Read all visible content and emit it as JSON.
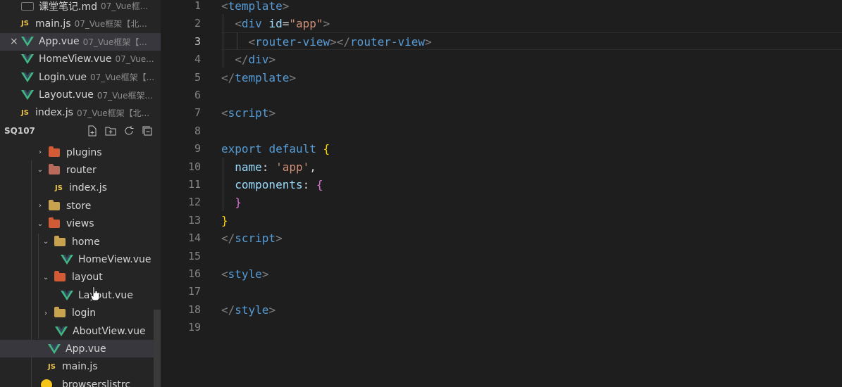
{
  "open_editors": [
    {
      "name": "课堂笔记.md",
      "desc": "07_Vue框...",
      "icon": "markdown-icon"
    },
    {
      "name": "main.js",
      "desc": "07_Vue框架【北...",
      "icon": "js-icon"
    },
    {
      "name": "App.vue",
      "desc": "07_Vue框架【...",
      "icon": "vue-icon",
      "close": "×",
      "selected": true
    },
    {
      "name": "HomeView.vue",
      "desc": "07_Vue...",
      "icon": "vue-icon"
    },
    {
      "name": "Login.vue",
      "desc": "07_Vue框架【...",
      "icon": "vue-icon"
    },
    {
      "name": "Layout.vue",
      "desc": "07_Vue框架...",
      "icon": "vue-icon"
    },
    {
      "name": "index.js",
      "desc": "07_Vue框架【北...",
      "icon": "js-icon"
    }
  ],
  "explorer": {
    "root": "SQ107",
    "actions": [
      "new-file-icon",
      "new-folder-icon",
      "refresh-icon",
      "collapse-all-icon"
    ],
    "tree": [
      {
        "name": "plugins",
        "type": "folder",
        "chevron": "›",
        "folder": "special"
      },
      {
        "name": "router",
        "type": "folder",
        "chevron": "⌄",
        "folder": "router"
      },
      {
        "name": "index.js",
        "type": "js"
      },
      {
        "name": "store",
        "type": "folder",
        "chevron": "›",
        "folder": "plain"
      },
      {
        "name": "views",
        "type": "folder",
        "chevron": "⌄",
        "folder": "special"
      },
      {
        "name": "home",
        "type": "folder",
        "chevron": "⌄",
        "folder": "plain"
      },
      {
        "name": "HomeView.vue",
        "type": "vue"
      },
      {
        "name": "layout",
        "type": "folder",
        "chevron": "⌄",
        "folder": "special"
      },
      {
        "name": "Layout.vue",
        "type": "vue"
      },
      {
        "name": "login",
        "type": "folder",
        "chevron": "›",
        "folder": "plain"
      },
      {
        "name": "AboutView.vue",
        "type": "vue"
      },
      {
        "name": "App.vue",
        "type": "vue",
        "selected": true
      },
      {
        "name": "main.js",
        "type": "js"
      },
      {
        "name": "browserslistrc",
        "type": "rc"
      }
    ]
  },
  "js_label": "JS",
  "editor": {
    "active_line": 3,
    "lines": [
      {
        "n": "1",
        "tokens": [
          [
            "t-ang",
            "<"
          ],
          [
            "t-tag",
            "template"
          ],
          [
            "t-ang",
            ">"
          ]
        ]
      },
      {
        "n": "2",
        "tokens": [
          [
            "t-pun",
            "  "
          ],
          [
            "t-ang",
            "<"
          ],
          [
            "t-tag",
            "div"
          ],
          [
            "t-pun",
            " "
          ],
          [
            "t-attr",
            "id"
          ],
          [
            "t-pun",
            "="
          ],
          [
            "t-str",
            "\"app\""
          ],
          [
            "t-ang",
            ">"
          ]
        ]
      },
      {
        "n": "3",
        "tokens": [
          [
            "t-pun",
            "    "
          ],
          [
            "t-ang",
            "<"
          ],
          [
            "t-tag",
            "router-view"
          ],
          [
            "t-ang",
            "></"
          ],
          [
            "t-tag",
            "router-view"
          ],
          [
            "t-ang",
            ">"
          ]
        ]
      },
      {
        "n": "4",
        "tokens": [
          [
            "t-pun",
            "  "
          ],
          [
            "t-ang",
            "</"
          ],
          [
            "t-tag",
            "div"
          ],
          [
            "t-ang",
            ">"
          ]
        ]
      },
      {
        "n": "5",
        "tokens": [
          [
            "t-ang",
            "</"
          ],
          [
            "t-tag",
            "template"
          ],
          [
            "t-ang",
            ">"
          ]
        ]
      },
      {
        "n": "6",
        "tokens": []
      },
      {
        "n": "7",
        "tokens": [
          [
            "t-ang",
            "<"
          ],
          [
            "t-tag",
            "script"
          ],
          [
            "t-ang",
            ">"
          ]
        ]
      },
      {
        "n": "8",
        "tokens": []
      },
      {
        "n": "9",
        "tokens": [
          [
            "t-kw",
            "export"
          ],
          [
            "t-pun",
            " "
          ],
          [
            "t-kw",
            "default"
          ],
          [
            "t-pun",
            " "
          ],
          [
            "t-b1",
            "{"
          ]
        ]
      },
      {
        "n": "10",
        "tokens": [
          [
            "t-pun",
            "  "
          ],
          [
            "t-prop",
            "name"
          ],
          [
            "t-pun",
            ": "
          ],
          [
            "t-str",
            "'app'"
          ],
          [
            "t-pun",
            ","
          ]
        ]
      },
      {
        "n": "11",
        "tokens": [
          [
            "t-pun",
            "  "
          ],
          [
            "t-prop",
            "components"
          ],
          [
            "t-pun",
            ": "
          ],
          [
            "t-b2",
            "{"
          ]
        ]
      },
      {
        "n": "12",
        "tokens": [
          [
            "t-pun",
            "  "
          ],
          [
            "t-b2",
            "}"
          ]
        ]
      },
      {
        "n": "13",
        "tokens": [
          [
            "t-b1",
            "}"
          ]
        ]
      },
      {
        "n": "14",
        "tokens": [
          [
            "t-ang",
            "</"
          ],
          [
            "t-tag",
            "script"
          ],
          [
            "t-ang",
            ">"
          ]
        ]
      },
      {
        "n": "15",
        "tokens": []
      },
      {
        "n": "16",
        "tokens": [
          [
            "t-ang",
            "<"
          ],
          [
            "t-tag",
            "style"
          ],
          [
            "t-ang",
            ">"
          ]
        ]
      },
      {
        "n": "17",
        "tokens": []
      },
      {
        "n": "18",
        "tokens": [
          [
            "t-ang",
            "</"
          ],
          [
            "t-tag",
            "style"
          ],
          [
            "t-ang",
            ">"
          ]
        ]
      },
      {
        "n": "19",
        "tokens": []
      }
    ]
  }
}
